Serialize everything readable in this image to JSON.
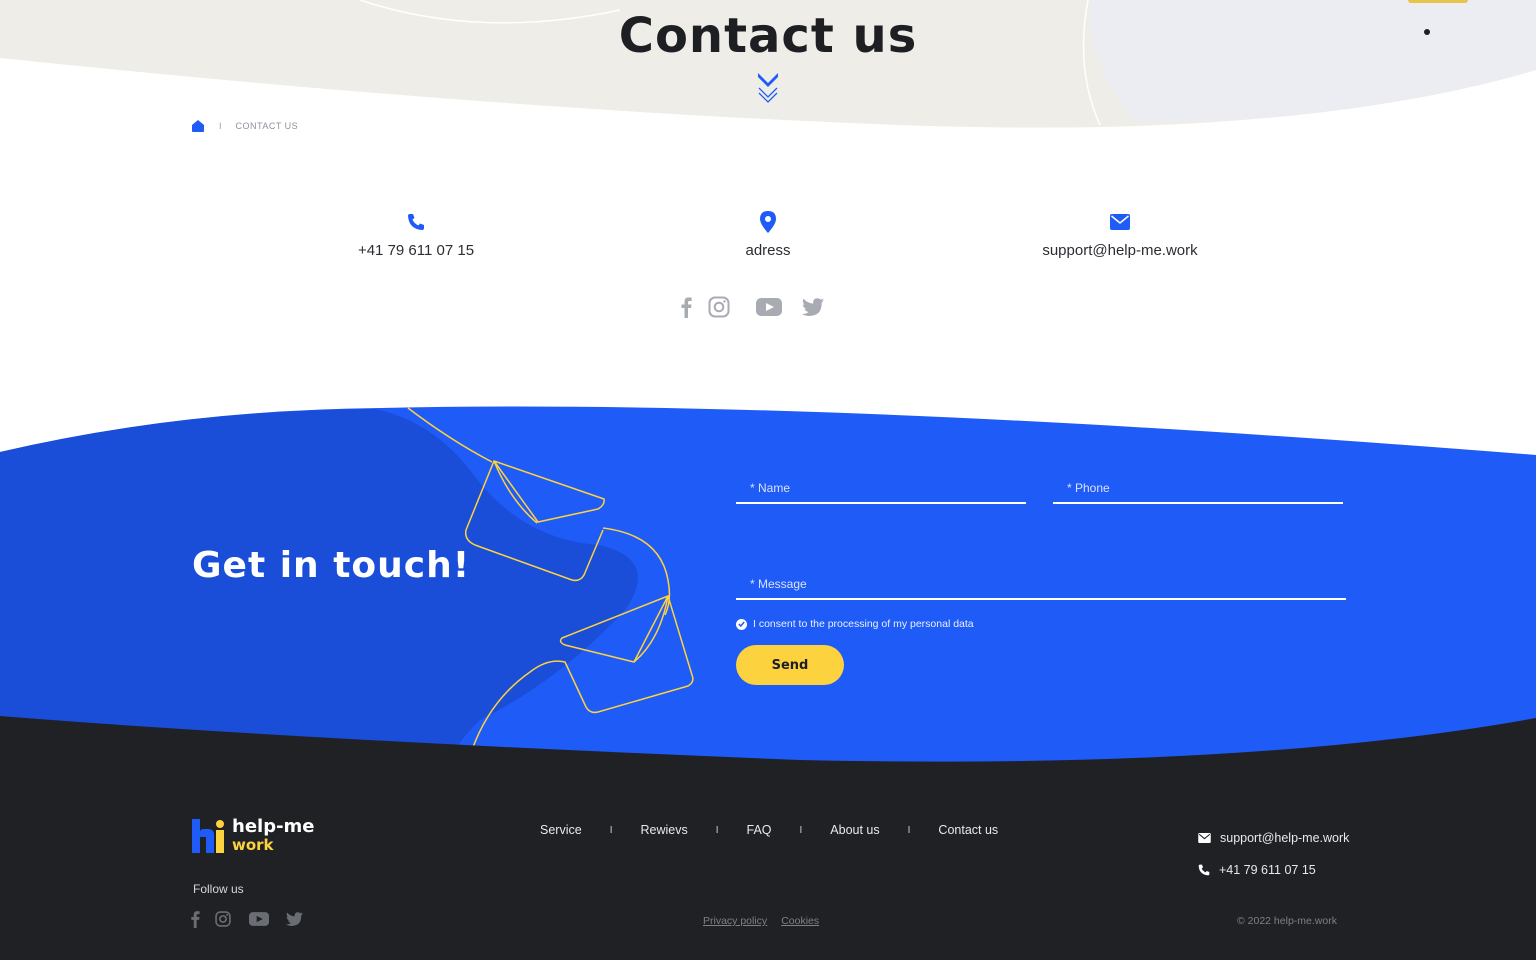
{
  "hero": {
    "title": "Contact us"
  },
  "breadcrumb": {
    "separator": "I",
    "current": "CONTACT US"
  },
  "contacts": {
    "phone": {
      "icon": "phone-icon",
      "text": "+41 79 611 07 15"
    },
    "address": {
      "icon": "location-pin-icon",
      "text": "adress"
    },
    "email": {
      "icon": "envelope-icon",
      "text": "support@help-me.work"
    }
  },
  "socials": [
    "facebook-icon",
    "instagram-icon",
    "youtube-icon",
    "twitter-icon"
  ],
  "get_in_touch": {
    "title": "Get in touch!",
    "name_placeholder": "* Name",
    "phone_placeholder": "* Phone",
    "message_placeholder": "* Message",
    "consent_text": "I consent to the processing of my personal data",
    "send_label": "Send"
  },
  "footer": {
    "logo_line1": "help-me",
    "logo_line2": "work",
    "follow_label": "Follow us",
    "nav": [
      "Service",
      "Rewievs",
      "FAQ",
      "About us",
      "Contact us"
    ],
    "nav_separator": "I",
    "email": "support@help-me.work",
    "phone": "+41 79 611 07 15",
    "privacy": "Privacy policy",
    "cookies": "Cookies",
    "copyright": "© 2022 help-me.work"
  },
  "colors": {
    "blue": "#1f5bf7",
    "blue_dark": "#1a4ed9",
    "yellow": "#fdd23f",
    "footer_bg": "#202124",
    "hero_bg": "#eeede8"
  }
}
